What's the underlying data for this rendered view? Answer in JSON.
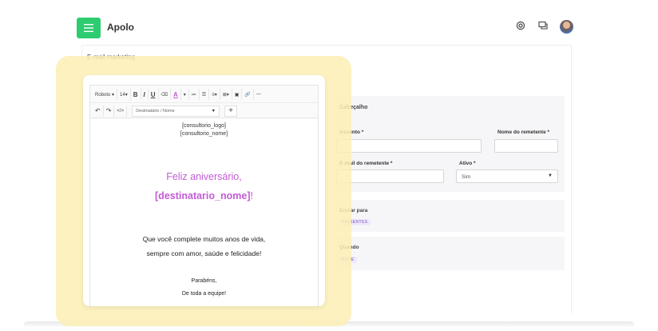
{
  "app": {
    "brand": "Apolo",
    "menu_icon": "hamburger-icon",
    "top_icons": [
      "support-icon",
      "chat-icon"
    ],
    "accent_color": "#2ecc71"
  },
  "page": {
    "title": "E-mail marketing"
  },
  "form": {
    "header_section": "Cabeçalho",
    "subject_label": "Assunto *",
    "subject_value": "",
    "sender_name_label": "Nome do remetente *",
    "sender_name_value": "",
    "sender_email_label": "E-mail do remetente *",
    "sender_email_value": "",
    "active_label": "Ativo *",
    "active_value": "Sim",
    "send_to_label": "Enviar para",
    "send_to_tag": "PACIENTES",
    "when_label": "Quando",
    "when_tag": "HOJE"
  },
  "editor": {
    "toolbar": {
      "font": "Roboto ▾",
      "size": "14▾",
      "bold": "B",
      "italic": "I",
      "underline": "U",
      "eraser": "⌫",
      "color": "A",
      "color_caret": "▾",
      "ordered_list": "≔",
      "bullet_list": "☰",
      "align": "≡▾",
      "table": "⊞▾",
      "image": "▣",
      "link": "🔗",
      "hr": "—",
      "undo": "↶",
      "redo": "↷",
      "code": "</>",
      "variable_placeholder": "Destinatário / Nome",
      "variable_caret": "▼",
      "add": "+"
    },
    "content": {
      "logo_var": "[consultorio_logo]",
      "name_var": "[consultorio_nome]",
      "greeting": "Feliz aniversário,",
      "recipient_var": "[destinatario_nome]",
      "exclamation": "!",
      "body_line1": "Que você complete muitos anos de vida,",
      "body_line2": "sempre com amor, saúde e felicidade!",
      "sign1": "Parabéns,",
      "sign2": "De toda a equipe!"
    },
    "highlight_color": "#c45bd6"
  }
}
